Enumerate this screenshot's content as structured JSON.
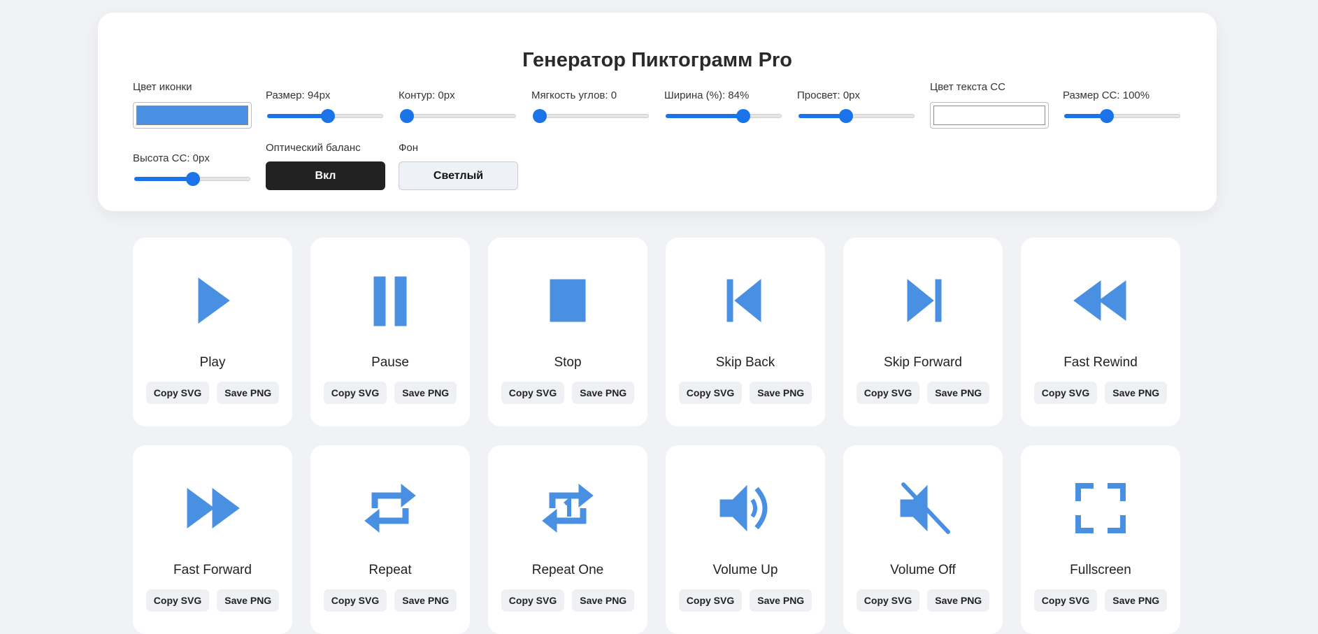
{
  "title": "Генератор Пиктограмм Pro",
  "colors": {
    "icon": "#4a90e2",
    "accent": "#1a73e8"
  },
  "controls": {
    "icon_color": {
      "label": "Цвет иконки",
      "value": "#4a90e2"
    },
    "size": {
      "label": "Размер: 94px",
      "level_pct": 53
    },
    "stroke": {
      "label": "Контур: 0px",
      "level_pct": 0
    },
    "radius": {
      "label": "Мягкость углов: 0",
      "level_pct": 0
    },
    "width": {
      "label": "Ширина (%): 84%",
      "level_pct": 69
    },
    "gap": {
      "label": "Просвет: 0px",
      "level_pct": 40
    },
    "cc_color": {
      "label": "Цвет текста CC",
      "value": "#ffffff"
    },
    "cc_size": {
      "label": "Размер CC: 100%",
      "level_pct": 35
    },
    "cc_height": {
      "label": "Высота CC: 0px",
      "level_pct": 51
    },
    "optical": {
      "label": "Оптический баланс",
      "button": "Вкл"
    },
    "background": {
      "label": "Фон",
      "button": "Светлый"
    }
  },
  "buttons": {
    "copy": "Copy SVG",
    "save": "Save PNG"
  },
  "icons": [
    {
      "name": "Play",
      "icon": "play-icon"
    },
    {
      "name": "Pause",
      "icon": "pause-icon"
    },
    {
      "name": "Stop",
      "icon": "stop-icon"
    },
    {
      "name": "Skip Back",
      "icon": "skip-back-icon"
    },
    {
      "name": "Skip Forward",
      "icon": "skip-forward-icon"
    },
    {
      "name": "Fast Rewind",
      "icon": "fast-rewind-icon"
    },
    {
      "name": "Fast Forward",
      "icon": "fast-forward-icon"
    },
    {
      "name": "Repeat",
      "icon": "repeat-icon"
    },
    {
      "name": "Repeat One",
      "icon": "repeat-one-icon"
    },
    {
      "name": "Volume Up",
      "icon": "volume-up-icon"
    },
    {
      "name": "Volume Off",
      "icon": "volume-off-icon"
    },
    {
      "name": "Fullscreen",
      "icon": "fullscreen-icon"
    }
  ]
}
